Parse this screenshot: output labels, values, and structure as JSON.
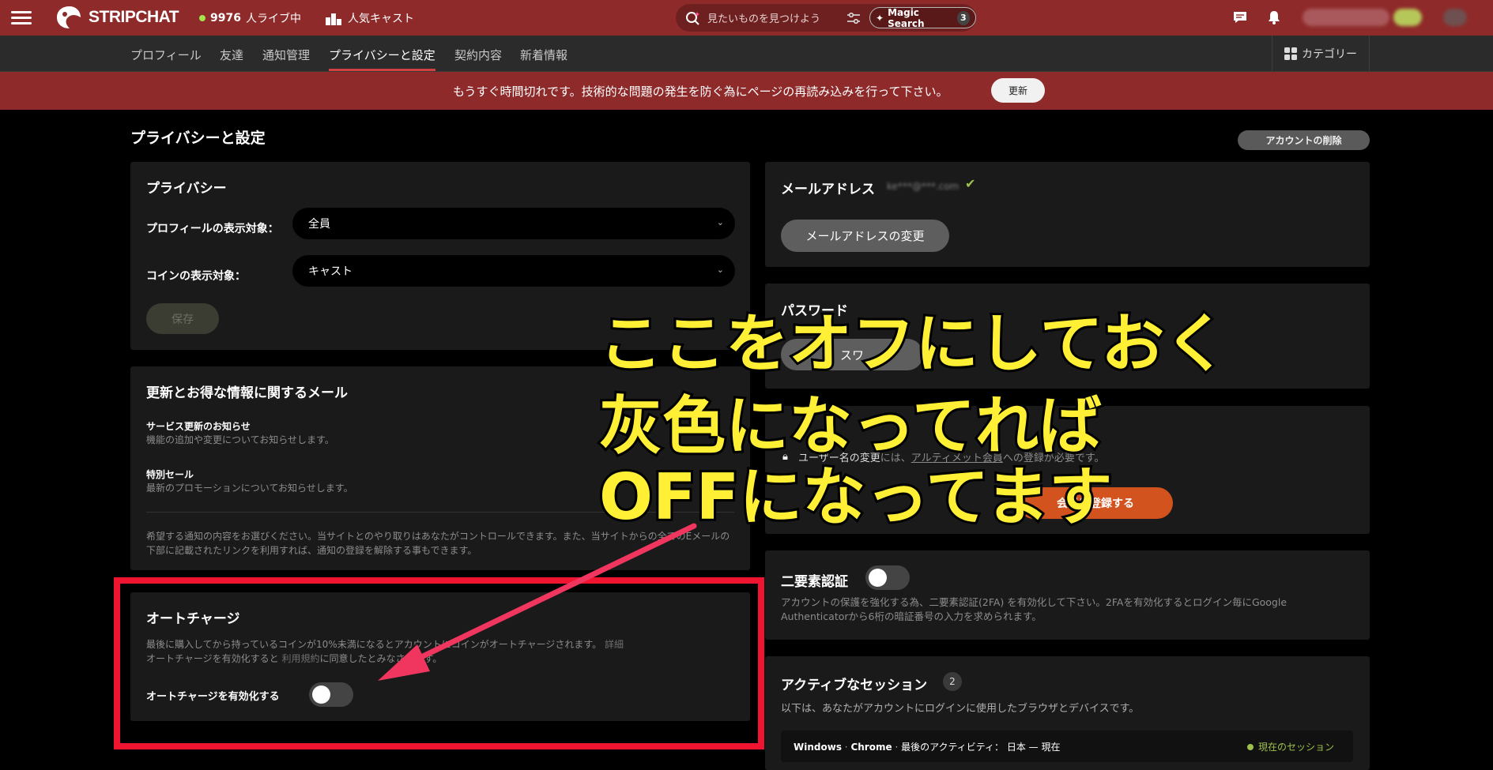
{
  "topbar": {
    "logo_text": "STRIPCHAT",
    "live_count": "9976",
    "live_suffix": "人ライブ中",
    "popular_label": "人気キャスト",
    "search_placeholder": "見たいものを見つけよう",
    "magic_label": "Magic Search",
    "magic_count": "3"
  },
  "subnav": {
    "tabs": [
      "プロフィール",
      "友達",
      "通知管理",
      "プライバシーと設定",
      "契約内容",
      "新着情報"
    ],
    "active_tab": "プライバシーと設定",
    "category_label": "カテゴリー"
  },
  "banner": {
    "message": "もうすぐ時間切れです。技術的な問題の発生を防ぐ為にページの再読み込みを行って下さい。",
    "button": "更新"
  },
  "page": {
    "title": "プライバシーと設定",
    "delete_button": "アカウントの削除"
  },
  "privacy": {
    "title": "プライバシー",
    "profile_visibility_label": "プロフィールの表示対象：",
    "profile_visibility_value": "全員",
    "coin_visibility_label": "コインの表示対象：",
    "coin_visibility_value": "キャスト",
    "save_button": "保存"
  },
  "mail": {
    "title": "更新とお得な情報に関するメール",
    "service_title": "サービス更新のお知らせ",
    "service_desc": "機能の追加や変更についてお知らせします。",
    "sale_title": "特別セール",
    "sale_desc": "最新のプロモーションについてお知らせします。",
    "note_line1": "希望する通知の内容をお選びください。当サイトとのやり取りはあなたがコントロールできます。また、当サイトからの全てのEメールの",
    "note_line2": "下部に記載されたリンクを利用すれば、通知の登録を解除する事もできます。"
  },
  "autocharge": {
    "title": "オートチャージ",
    "desc_line1": "最後に購入してから持っているコインが10%未満になるとアカウントにコインがオートチャージされます。",
    "desc_link": "詳細",
    "desc_line2": "オートチャージを有効化すると",
    "terms_link": "利用規約",
    "desc_line2_end": "に同意したとみなされます。",
    "toggle_label": "オートチャージを有効化する",
    "enabled": false
  },
  "email_card": {
    "title": "メールアドレス",
    "masked": "ke***@***.com",
    "button": "メールアドレスの変更"
  },
  "password_card": {
    "title": "パスワード",
    "button_partial": "スワ"
  },
  "username_card": {
    "note_prefix": "ユーザー名の変更",
    "note_mid": "には、",
    "note_link": "アルティメット会員",
    "note_end": "への登録が必要です。",
    "button": "会員に登録する"
  },
  "twofa": {
    "title": "二要素認証",
    "desc_line1": "アカウントの保護を強化する為、二要素認証(2FA) を有効化して下さい。2FAを有効化するとログイン毎にGoogle",
    "desc_line2": "Authenticatorから6桁の暗証番号の入力を求められます。",
    "enabled": false
  },
  "sessions": {
    "title": "アクティブなセッション",
    "count": "2",
    "desc": "以下は、あなたがアカウントにログインに使用したブラウザとデバイスです。",
    "os": "Windows",
    "browser": "Chrome",
    "activity": "最後のアクティビティ： 日本 — 現在",
    "current": "現在のセッション"
  },
  "annotation": {
    "line1": "ここをオフにしておく",
    "line2": "灰色になってれば",
    "line3": "OFFになってます"
  },
  "colors": {
    "brand_red": "#8f2a2a",
    "frame_red": "#ef1530",
    "annotation_yellow": "#fff036",
    "arrow_pink": "#f0365e"
  }
}
